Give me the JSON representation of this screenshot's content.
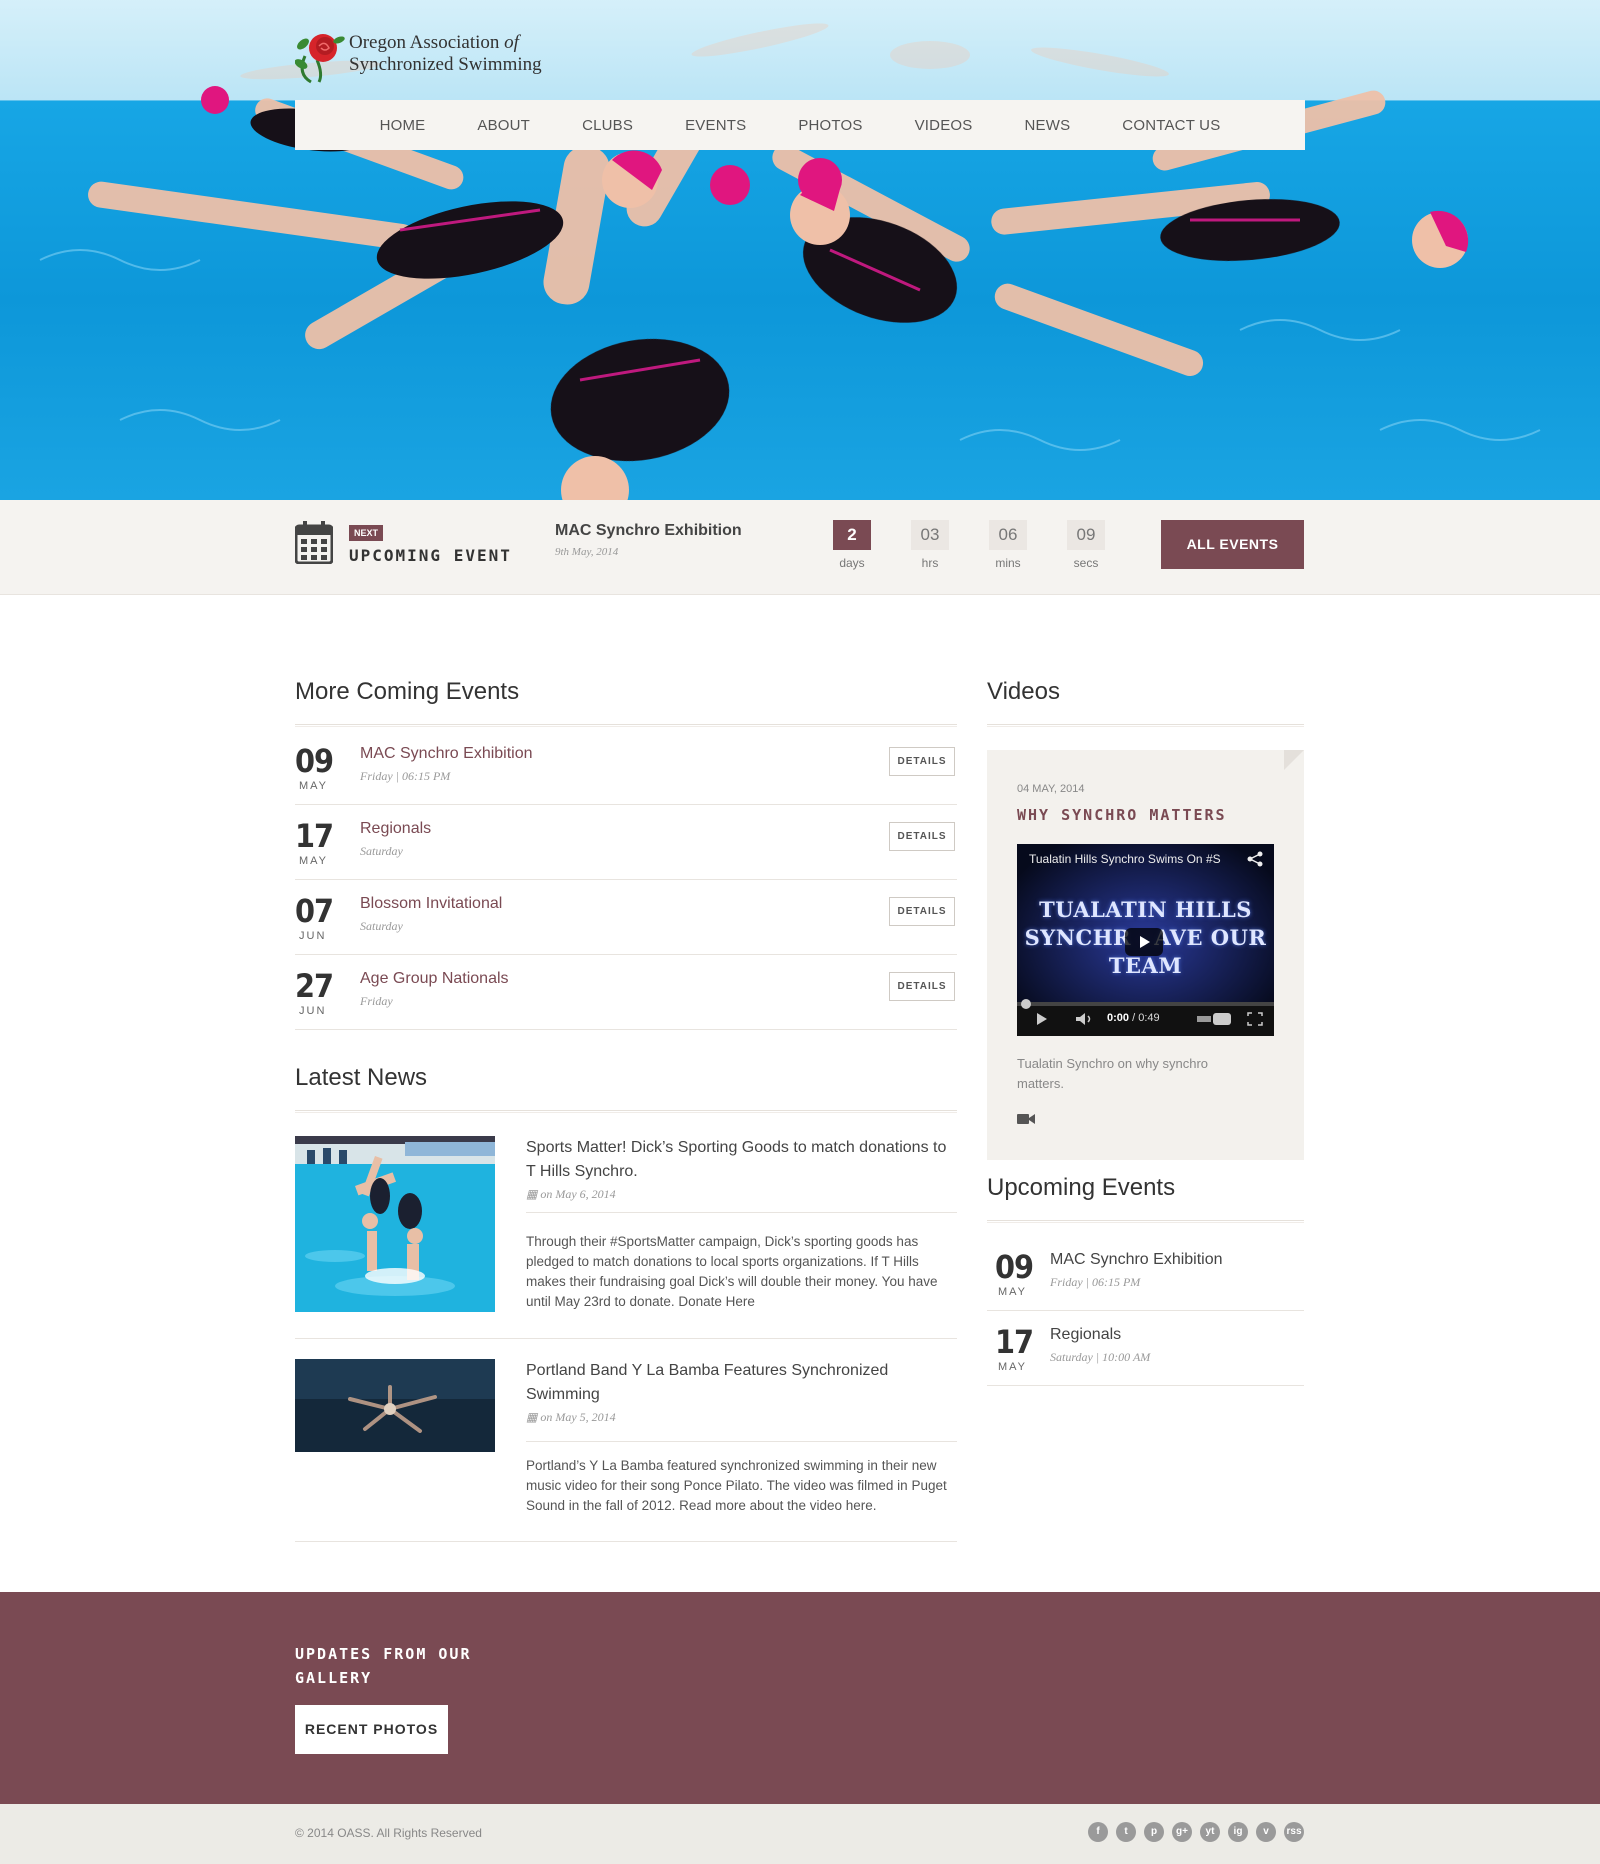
{
  "brand": {
    "line1": "Oregon Association",
    "of": "of",
    "line2": "Synchronized Swimming"
  },
  "nav": [
    "HOME",
    "ABOUT",
    "CLUBS",
    "EVENTS",
    "PHOTOS",
    "VIDEOS",
    "NEWS",
    "CONTACT US"
  ],
  "upcoming": {
    "badge": "NEXT",
    "label": "UPCOMING EVENT",
    "title": "MAC Synchro Exhibition",
    "date": "9th May, 2014",
    "countdown": [
      {
        "value": "2",
        "unit": "days"
      },
      {
        "value": "03",
        "unit": "hrs"
      },
      {
        "value": "06",
        "unit": "mins"
      },
      {
        "value": "09",
        "unit": "secs"
      }
    ],
    "all_events": "ALL EVENTS"
  },
  "more_events": {
    "title": "More Coming Events",
    "details_label": "DETAILS",
    "items": [
      {
        "day": "09",
        "month": "MAY",
        "name": "MAC Synchro Exhibition",
        "sub": "Friday | 06:15 PM"
      },
      {
        "day": "17",
        "month": "MAY",
        "name": "Regionals",
        "sub": "Saturday"
      },
      {
        "day": "07",
        "month": "JUN",
        "name": "Blossom Invitational",
        "sub": "Saturday"
      },
      {
        "day": "27",
        "month": "JUN",
        "name": "Age Group Nationals",
        "sub": "Friday"
      }
    ]
  },
  "news": {
    "title": "Latest News",
    "items": [
      {
        "title": "Sports Matter! Dick’s Sporting Goods to match donations to T Hills Synchro.",
        "date": "on May 6, 2014",
        "body": "Through their #SportsMatter campaign, Dick’s sporting goods has pledged to match donations to local sports organizations.  If T Hills makes their fundraising goal Dick’s will double their money. You have until May 23rd to donate. Donate Here"
      },
      {
        "title": "Portland Band Y La Bamba Features Synchronized Swimming",
        "date": "on May 5, 2014",
        "body": "Portland’s Y La Bamba featured synchronized swimming in their new music video for their song Ponce Pilato.  The video was filmed in Puget Sound in the fall of 2012.  Read more about the video here."
      }
    ]
  },
  "videos": {
    "title": "Videos",
    "date": "04 MAY, 2014",
    "video_title": "WHY SYNCHRO MATTERS",
    "player_title": "Tualatin Hills Synchro Swims On #S",
    "player_line1": "TUALATIN HILLS",
    "player_line2": "SYNCHR   AVE OUR",
    "player_line3": "TEAM",
    "time_current": "0:00",
    "time_total": " / 0:49",
    "description": "Tualatin Synchro on why synchro matters."
  },
  "side_events": {
    "title": "Upcoming Events",
    "items": [
      {
        "day": "09",
        "month": "MAY",
        "name": "MAC Synchro Exhibition",
        "sub": "Friday | 06:15 PM"
      },
      {
        "day": "17",
        "month": "MAY",
        "name": "Regionals",
        "sub": "Saturday | 10:00 AM"
      }
    ]
  },
  "gallery": {
    "title": "UPDATES FROM OUR GALLERY",
    "button": "RECENT PHOTOS"
  },
  "footer": {
    "copyright": "© 2014 OASS. All Rights Reserved",
    "social": [
      "f",
      "t",
      "p",
      "g+",
      "yt",
      "ig",
      "v",
      "rss"
    ]
  },
  "colors": {
    "accent": "#7a4a53",
    "pool": "#0d97d9"
  }
}
